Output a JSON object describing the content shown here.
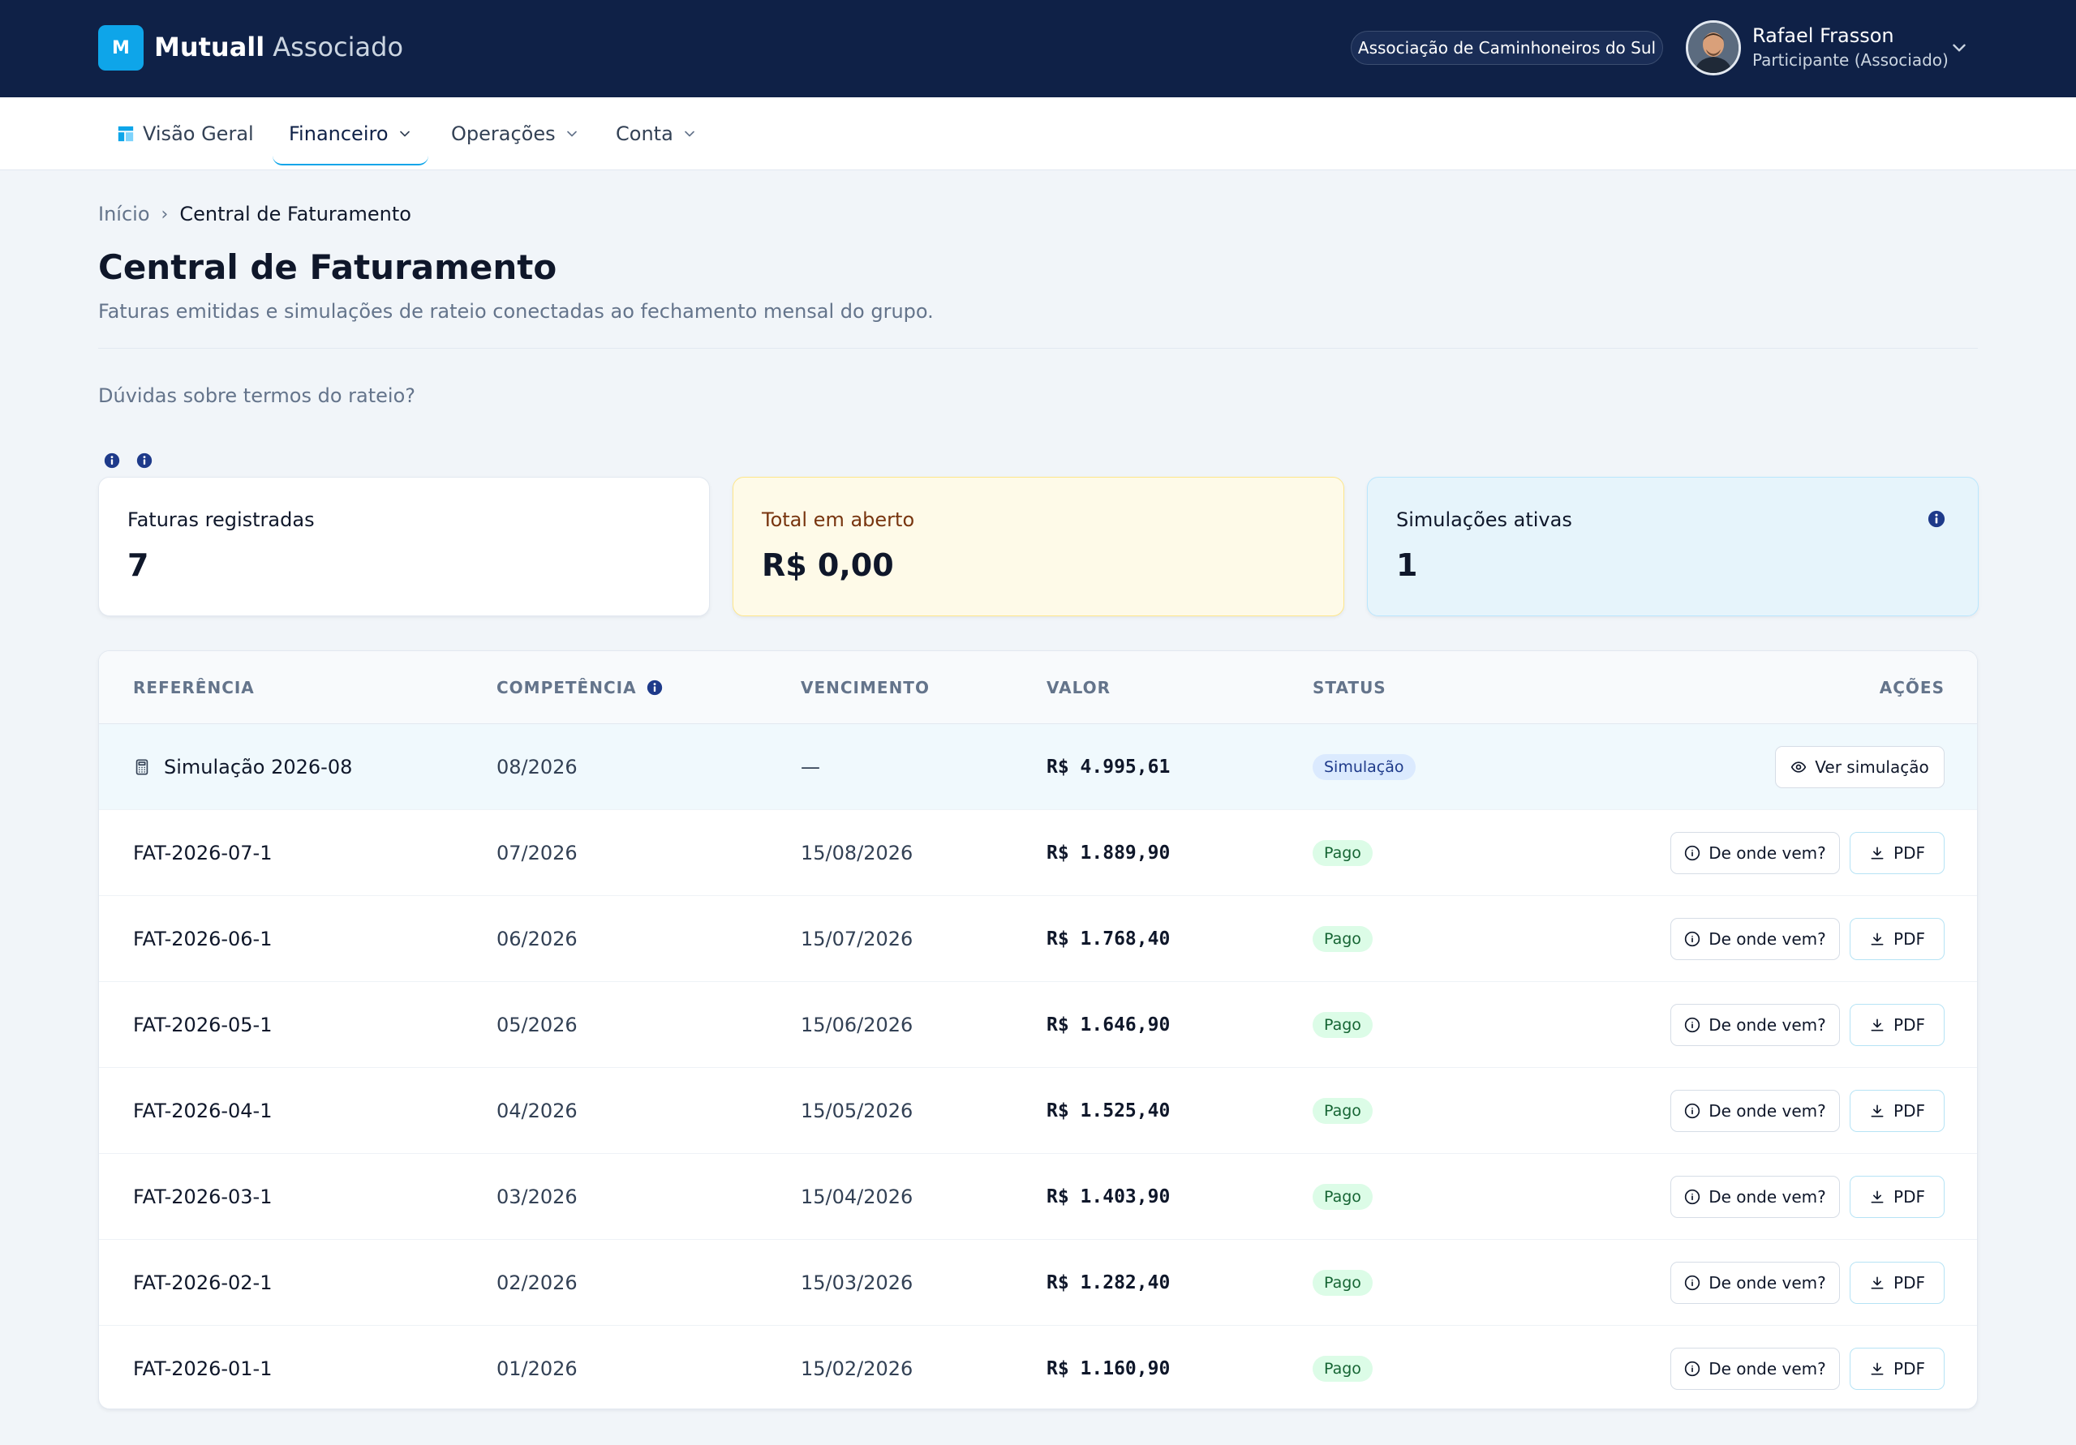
{
  "brand": {
    "logo_letter": "M",
    "name": "Mutuall",
    "suffix": "Associado"
  },
  "header": {
    "organization": "Associação de Caminhoneiros do Sul",
    "user": {
      "name": "Rafael Frasson",
      "role": "Participante (Associado)"
    }
  },
  "nav": {
    "items": [
      {
        "label": "Visão Geral",
        "icon": "dashboard-icon",
        "active": false,
        "has_dropdown": false
      },
      {
        "label": "Financeiro",
        "active": true,
        "has_dropdown": true
      },
      {
        "label": "Operações",
        "active": false,
        "has_dropdown": true
      },
      {
        "label": "Conta",
        "active": false,
        "has_dropdown": true
      }
    ]
  },
  "breadcrumb": {
    "home": "Início",
    "separator": "›",
    "current": "Central de Faturamento"
  },
  "page": {
    "title": "Central de Faturamento",
    "subtitle": "Faturas emitidas e simulações de rateio conectadas ao fechamento mensal do grupo.",
    "help_link": "Dúvidas sobre termos do rateio?"
  },
  "stats": [
    {
      "label": "Faturas registradas",
      "value": "7",
      "variant": "default"
    },
    {
      "label": "Total em aberto",
      "value": "R$ 0,00",
      "variant": "warning"
    },
    {
      "label": "Simulações ativas",
      "value": "1",
      "variant": "info"
    }
  ],
  "table": {
    "columns": [
      "REFERÊNCIA",
      "COMPETÊNCIA",
      "VENCIMENTO",
      "VALOR",
      "STATUS",
      "AÇÕES"
    ],
    "rows": [
      {
        "ref": "Simulação 2026-08",
        "competencia": "08/2026",
        "vencimento": "—",
        "valor": "R$ 4.995,61",
        "status": "Simulação",
        "type": "simulation",
        "action": "Ver simulação"
      },
      {
        "ref": "FAT-2026-07-1",
        "competencia": "07/2026",
        "vencimento": "15/08/2026",
        "valor": "R$ 1.889,90",
        "status": "Pago",
        "type": "invoice",
        "action_origin": "De onde vem?",
        "action_pdf": "PDF"
      },
      {
        "ref": "FAT-2026-06-1",
        "competencia": "06/2026",
        "vencimento": "15/07/2026",
        "valor": "R$ 1.768,40",
        "status": "Pago",
        "type": "invoice",
        "action_origin": "De onde vem?",
        "action_pdf": "PDF"
      },
      {
        "ref": "FAT-2026-05-1",
        "competencia": "05/2026",
        "vencimento": "15/06/2026",
        "valor": "R$ 1.646,90",
        "status": "Pago",
        "type": "invoice",
        "action_origin": "De onde vem?",
        "action_pdf": "PDF"
      },
      {
        "ref": "FAT-2026-04-1",
        "competencia": "04/2026",
        "vencimento": "15/05/2026",
        "valor": "R$ 1.525,40",
        "status": "Pago",
        "type": "invoice",
        "action_origin": "De onde vem?",
        "action_pdf": "PDF"
      },
      {
        "ref": "FAT-2026-03-1",
        "competencia": "03/2026",
        "vencimento": "15/04/2026",
        "valor": "R$ 1.403,90",
        "status": "Pago",
        "type": "invoice",
        "action_origin": "De onde vem?",
        "action_pdf": "PDF"
      },
      {
        "ref": "FAT-2026-02-1",
        "competencia": "02/2026",
        "vencimento": "15/03/2026",
        "valor": "R$ 1.282,40",
        "status": "Pago",
        "type": "invoice",
        "action_origin": "De onde vem?",
        "action_pdf": "PDF"
      },
      {
        "ref": "FAT-2026-01-1",
        "competencia": "01/2026",
        "vencimento": "15/02/2026",
        "valor": "R$ 1.160,90",
        "status": "Pago",
        "type": "invoice",
        "action_origin": "De onde vem?",
        "action_pdf": "PDF"
      }
    ]
  },
  "colors": {
    "topbar": "#0f2147",
    "accent": "#0ea5e9",
    "paid_badge_bg": "#dcfce7",
    "paid_badge_text": "#166534",
    "simulation_badge_bg": "#dbeafe",
    "simulation_badge_text": "#1e3a8a"
  }
}
